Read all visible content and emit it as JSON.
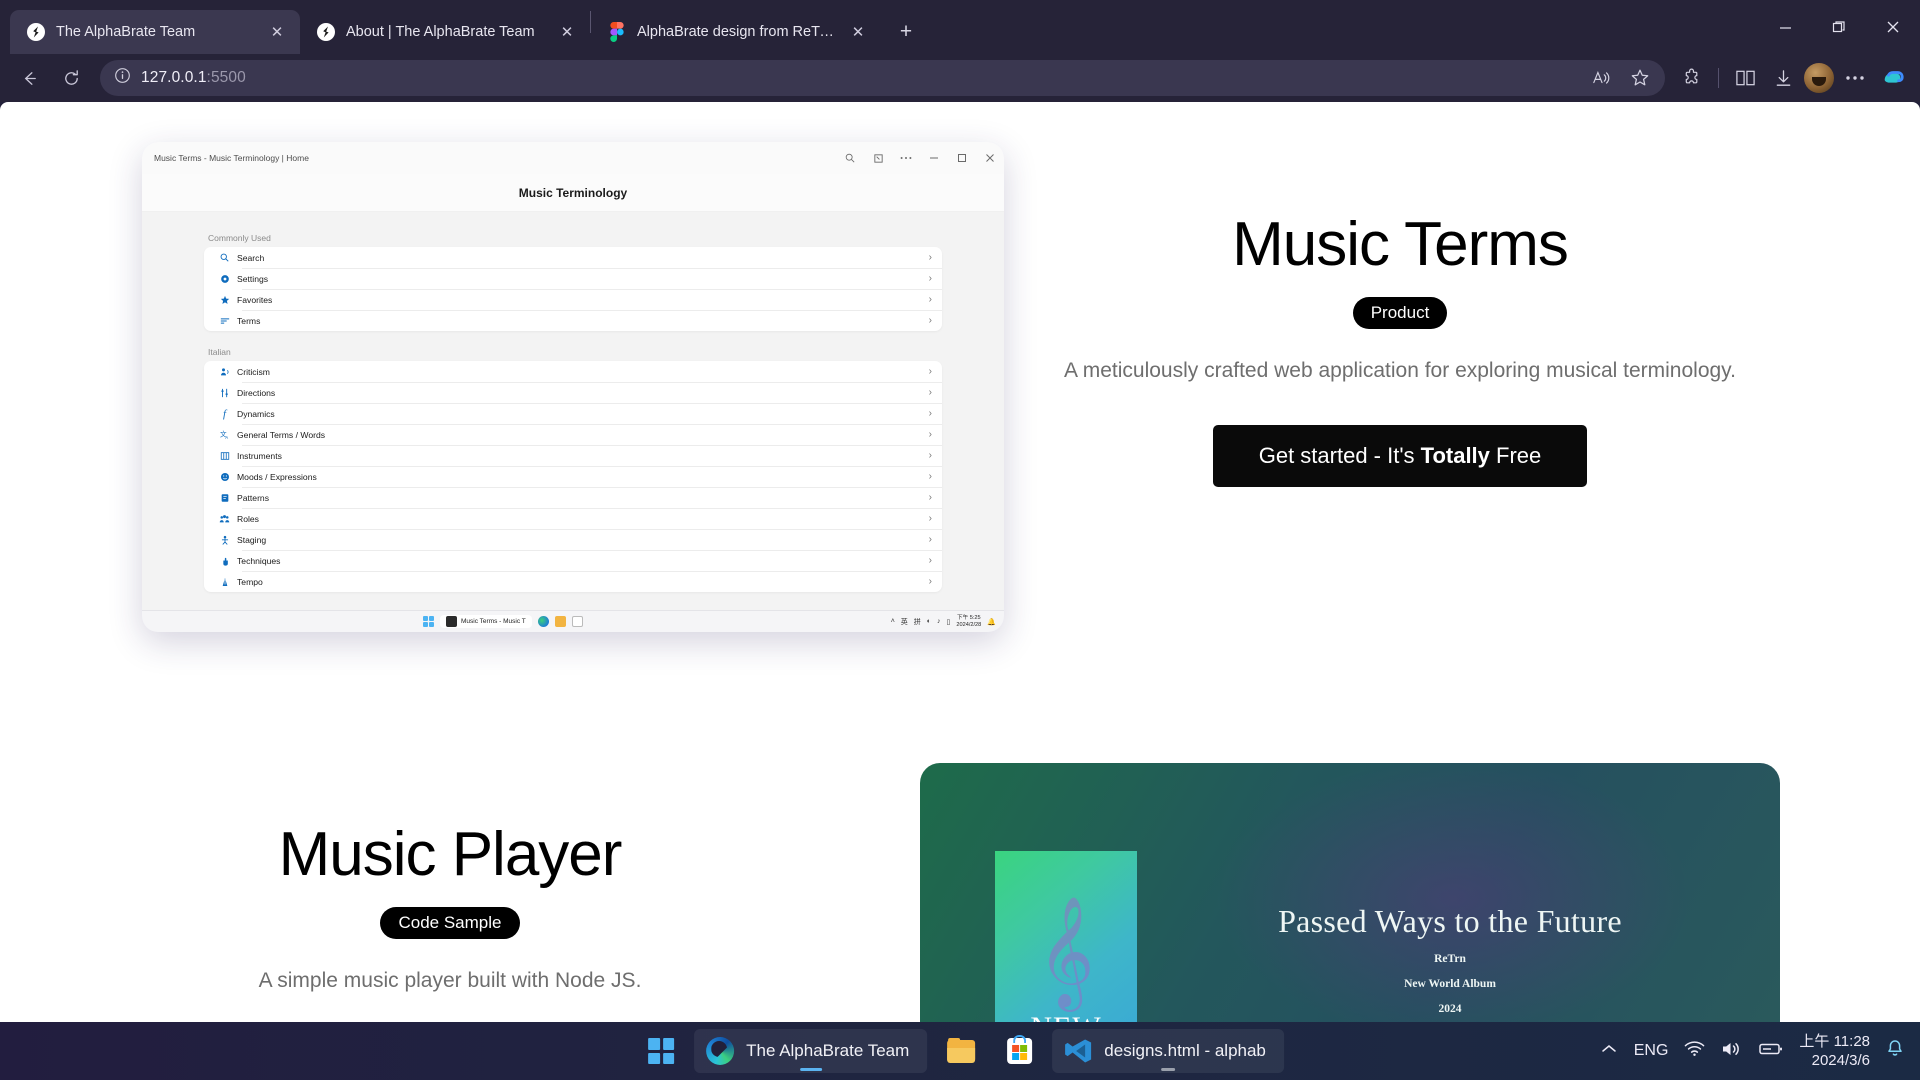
{
  "browser": {
    "tabs": [
      {
        "title": "The AlphaBrate Team",
        "favicon": "alphabrate-icon",
        "active": true,
        "close_label": "✕"
      },
      {
        "title": "About | The AlphaBrate Team",
        "favicon": "alphabrate-icon",
        "active": false,
        "close_label": "✕"
      },
      {
        "title": "AlphaBrate design from ReTrn –",
        "favicon": "figma-icon",
        "active": false,
        "close_label": ""
      }
    ],
    "new_tab_label": "+",
    "window_controls": {
      "minimize": "—",
      "maximize": "❐",
      "close": "✕"
    },
    "nav": {
      "back": "←",
      "reload": "⟳"
    },
    "address": {
      "host": "127.0.0.1",
      "port": ":5500",
      "info_icon": "info-circle-icon"
    },
    "toolbar_icons": [
      "read-aloud-icon",
      "favorite-star-icon",
      "extensions-icon",
      "split-screen-icon",
      "downloads-icon",
      "profile-avatar",
      "more-settings-icon",
      "copilot-icon"
    ]
  },
  "page": {
    "section_product": {
      "title": "Music Terms",
      "badge": "Product",
      "subtitle": "A meticulously crafted web application for exploring musical terminology.",
      "cta_prefix": "Get started - It's ",
      "cta_bold": "Totally",
      "cta_suffix": " Free"
    },
    "section_player": {
      "title": "Music Player",
      "badge": "Code Sample",
      "subtitle": "A simple music player built with Node JS."
    },
    "album": {
      "cover_label": "NEW",
      "title": "Passed Ways to the Future",
      "artist": "ReTrn",
      "album_line": "New World Album",
      "year": "2024",
      "cover_gradient_start": "#3ad47f",
      "cover_gradient_end": "#3aa8d6",
      "card_gradient_start": "#1e6b4a",
      "card_gradient_end": "#2a5a5c"
    }
  },
  "app_screenshot": {
    "window_title": "Music Terms - Music Terminology | Home",
    "header_title": "Music Terminology",
    "titlebar_icons": [
      "search-icon",
      "annotate-icon",
      "more-icon",
      "minimize-icon",
      "maximize-icon",
      "close-icon"
    ],
    "groups": [
      {
        "label": "Commonly Used",
        "items": [
          {
            "label": "Search",
            "icon": "search-icon",
            "chevron": "›"
          },
          {
            "label": "Settings",
            "icon": "gear-icon",
            "chevron": "›"
          },
          {
            "label": "Favorites",
            "icon": "star-icon",
            "chevron": "›"
          },
          {
            "label": "Terms",
            "icon": "list-icon",
            "chevron": "›"
          }
        ]
      },
      {
        "label": "Italian",
        "items": [
          {
            "label": "Criticism",
            "icon": "person-voice-icon",
            "chevron": "›"
          },
          {
            "label": "Directions",
            "icon": "sliders-icon",
            "chevron": "›"
          },
          {
            "label": "Dynamics",
            "icon": "forte-icon",
            "chevron": "›"
          },
          {
            "label": "General Terms / Words",
            "icon": "translate-icon",
            "chevron": "›"
          },
          {
            "label": "Instruments",
            "icon": "piano-icon",
            "chevron": "›"
          },
          {
            "label": "Moods / Expressions",
            "icon": "smiley-icon",
            "chevron": "›"
          },
          {
            "label": "Patterns",
            "icon": "pattern-icon",
            "chevron": "›"
          },
          {
            "label": "Roles",
            "icon": "people-icon",
            "chevron": "›"
          },
          {
            "label": "Staging",
            "icon": "staging-icon",
            "chevron": "›"
          },
          {
            "label": "Techniques",
            "icon": "hand-icon",
            "chevron": "›"
          },
          {
            "label": "Tempo",
            "icon": "metronome-icon",
            "chevron": "›"
          }
        ]
      }
    ],
    "taskbar": {
      "app_chip": "Music Terms - Music T",
      "items": [
        "start-icon",
        "edge-icon",
        "file-explorer-icon",
        "store-icon"
      ],
      "tray_glyphs": [
        "˄",
        "英",
        "拼"
      ],
      "time": "下午 5:25",
      "date": "2024/2/28"
    }
  },
  "windows_taskbar": {
    "items": [
      {
        "label": "",
        "icon": "start-icon"
      },
      {
        "label": "The AlphaBrate Team",
        "icon": "edge-icon",
        "open": true
      },
      {
        "label": "",
        "icon": "file-explorer-icon"
      },
      {
        "label": "",
        "icon": "store-icon"
      },
      {
        "label": "designs.html - alphab",
        "icon": "vscode-icon",
        "open": true
      }
    ],
    "tray": {
      "chevron": "˄",
      "language": "ENG",
      "icons": [
        "wifi-icon",
        "volume-icon",
        "battery-icon",
        "notification-bell-icon"
      ],
      "time": "上午 11:28",
      "date": "2024/3/6"
    }
  }
}
